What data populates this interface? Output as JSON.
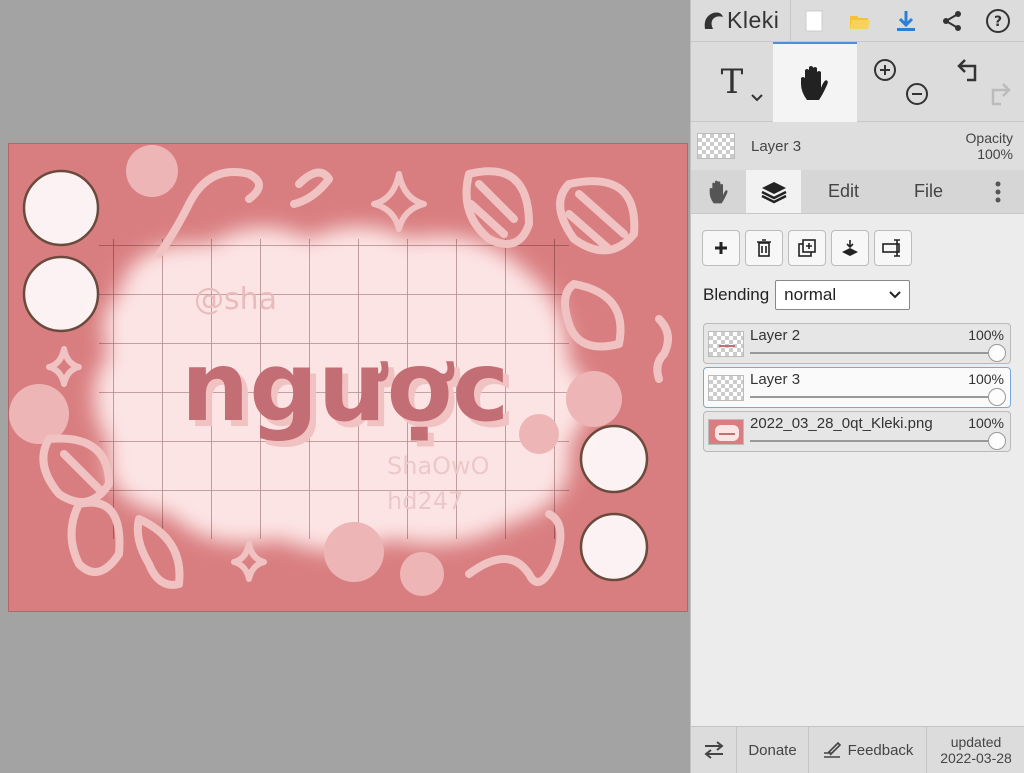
{
  "app": {
    "name": "Kleki"
  },
  "current_layer": {
    "name": "Layer 3",
    "opacity_label": "Opacity",
    "opacity_value": "100%"
  },
  "tabs": {
    "edit": "Edit",
    "file": "File"
  },
  "blending": {
    "label": "Blending",
    "value": "normal"
  },
  "layers": [
    {
      "name": "Layer 2",
      "opacity": "100%",
      "selected": false
    },
    {
      "name": "Layer 3",
      "opacity": "100%",
      "selected": true
    },
    {
      "name": "2022_03_28_0qt_Kleki.png",
      "opacity": "100%",
      "selected": false
    }
  ],
  "footer": {
    "donate": "Donate",
    "feedback": "Feedback",
    "updated_label": "updated",
    "updated_date": "2022-03-28"
  },
  "artwork": {
    "title_text": "ngược",
    "watermark_1": "@sha",
    "watermark_2": "ShaOwO",
    "watermark_3": "hd247"
  },
  "colors": {
    "accent": "#4a8fd8",
    "canvas_bg": "#d97e80",
    "art_light": "#fde4e4"
  }
}
